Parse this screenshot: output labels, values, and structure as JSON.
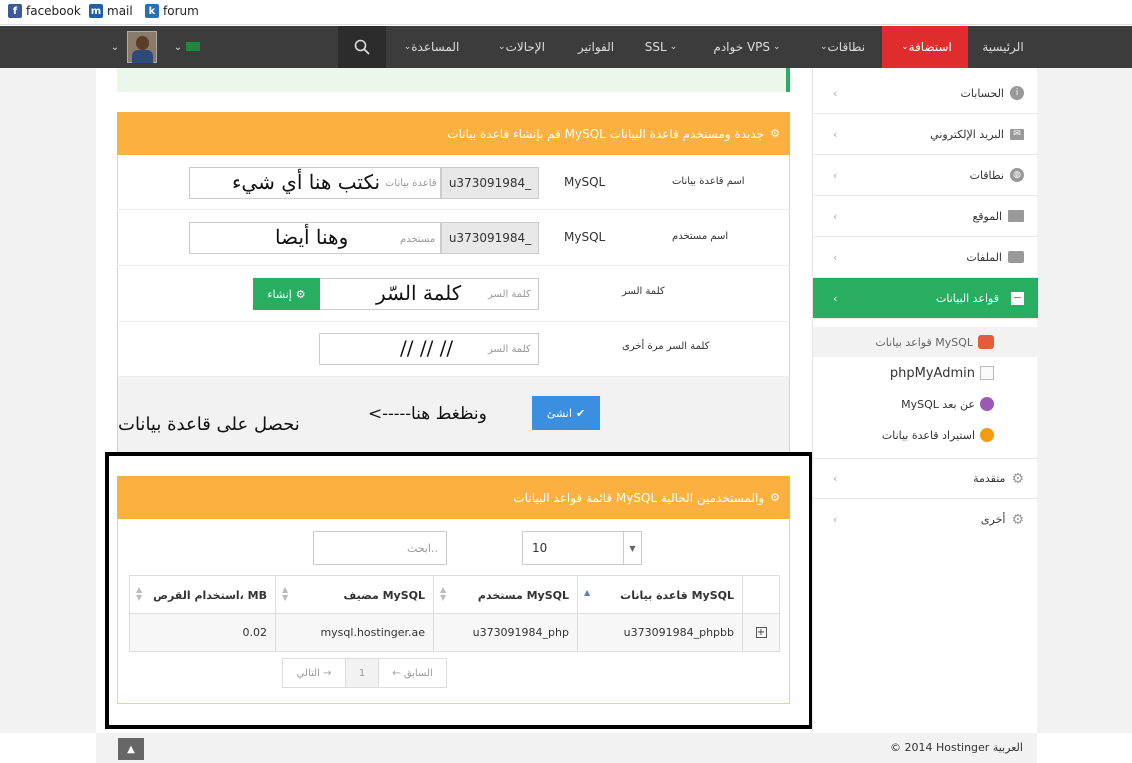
{
  "bookmarks": [
    {
      "label": "facebook",
      "icon": "facebook-icon",
      "color": "#3b5998",
      "glyph": "f"
    },
    {
      "label": "mail",
      "icon": "mail-icon",
      "color": "#1e5fa8",
      "glyph": "m"
    },
    {
      "label": "forum",
      "icon": "forum-icon",
      "color": "#2a6fb5",
      "glyph": "k"
    }
  ],
  "nav": {
    "home": "الرئيسية",
    "hosting": "استضافة",
    "domains": "نطاقات",
    "servers": "خوادم VPS",
    "ssl": "SSL",
    "invoices": "الفواتير",
    "referrals": "الإحالات",
    "help": "المساعدة",
    "active_color": "#e02c2c"
  },
  "sidebar": {
    "items": [
      {
        "label": "الحسابات",
        "icon": "info-icon"
      },
      {
        "label": "البريد الإلكتروني",
        "icon": "envelope-icon"
      },
      {
        "label": "نطاقات",
        "icon": "globe-icon"
      },
      {
        "label": "الموقع",
        "icon": "monitor-icon"
      },
      {
        "label": "الملفات",
        "icon": "folder-icon"
      },
      {
        "label": "قواعد البيانات",
        "icon": "minus-box-icon"
      }
    ],
    "subitems": [
      {
        "label": "قواعد بيانات MySQL",
        "icon": "mysql-icon"
      },
      {
        "label": "phpMyAdmin",
        "icon": "phpmyadmin-icon"
      },
      {
        "label": "MySQL عن بعد",
        "icon": "remote-db-icon"
      },
      {
        "label": "استيراد قاعدة بيانات",
        "icon": "import-db-icon"
      }
    ],
    "bottom": [
      {
        "label": "متقدمة",
        "icon": "gears-icon"
      },
      {
        "label": "أخرى",
        "icon": "gear-icon"
      }
    ],
    "active_color": "#27ae60"
  },
  "create_panel": {
    "title": "قم بإنشاء قاعدة بيانات MySQL جديدة ومستخدم قاعدة البيانات",
    "db_label": "اسم قاعدة بيانات",
    "db_type": "MySQL",
    "db_prefix": "u373091984_",
    "db_placeholder": "قاعدة بيانات",
    "db_written": "نكتب هنا أي شيء",
    "user_label": "اسم مستخدم",
    "user_type": "MySQL",
    "user_prefix": "u373091984_",
    "user_placeholder": "مستخدم",
    "user_written": "وهنا أيضا",
    "pass_label": "كلمة السر",
    "pass_placeholder": "كلمة السر",
    "pass_written": "كلمة السّر",
    "generate_btn": "إنشاء",
    "pass2_label": "كلمة السر مرة أخرى",
    "pass2_placeholder": "كلمة السر",
    "pass2_written": "//  //  //",
    "create_btn": "انشئ",
    "annotation_arrow": "<-----ونظغط هنا",
    "annotation_result": "نحصل على قاعدة بيانات"
  },
  "list_panel": {
    "title": "قائمة قواعد البيانات MySQL والمستخدمين الحالية",
    "page_size": "10",
    "search_placeholder": "ابحث..",
    "columns": [
      "قاعدة بيانات MySQL",
      "مستخدم MySQL",
      "مضيف MySQL",
      "استخدام القرص، MB"
    ],
    "rows": [
      [
        "u373091984_phpbb",
        "u373091984_php",
        "mysql.hostinger.ae",
        "0.02"
      ]
    ],
    "prev": "← السابق",
    "page": "1",
    "next": "التالي →"
  },
  "footer": {
    "copyright": "© 2014 Hostinger العربية"
  }
}
